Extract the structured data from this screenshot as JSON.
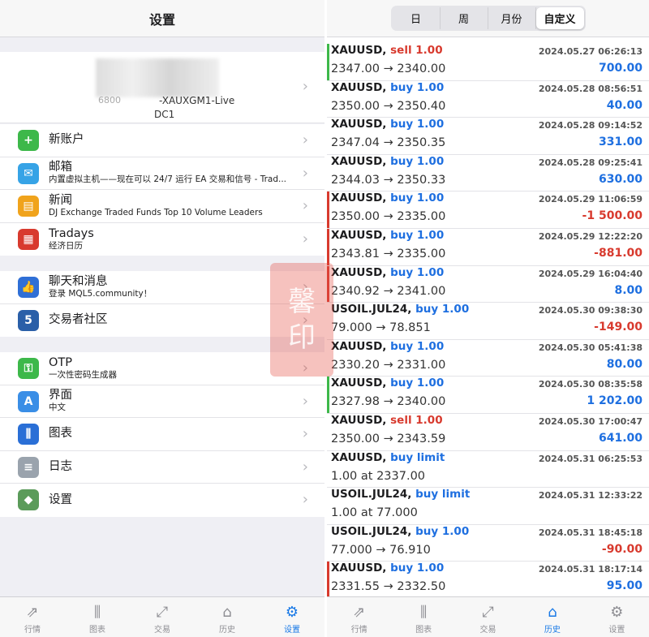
{
  "left": {
    "title": "设置",
    "account": {
      "number_partial": "6800",
      "server": "-XAUXGM1-Live",
      "dc": "DC1"
    },
    "group1": [
      {
        "icon": "new-account-icon",
        "color": "#3db84a",
        "glyph": "+",
        "title": "新账户",
        "sub": ""
      },
      {
        "icon": "mail-icon",
        "color": "#36a3e6",
        "glyph": "✉",
        "title": "邮箱",
        "sub": "内置虚拟主机——现在可以 24/7 运行 EA 交易和信号 - Trad..."
      },
      {
        "icon": "news-icon",
        "color": "#f0a31c",
        "glyph": "▤",
        "title": "新闻",
        "sub": "DJ Exchange Traded Funds Top 10 Volume Leaders"
      },
      {
        "icon": "tradays-icon",
        "color": "#d83a2e",
        "glyph": "▦",
        "title": "Tradays",
        "sub": "经济日历"
      }
    ],
    "group2": [
      {
        "icon": "chat-icon",
        "color": "#2f6fd6",
        "glyph": "👍",
        "title": "聊天和消息",
        "sub": "登录 MQL5.community！"
      },
      {
        "icon": "mql5-icon",
        "color": "#2a5fa8",
        "glyph": "5",
        "title": "交易者社区",
        "sub": ""
      }
    ],
    "group3": [
      {
        "icon": "otp-icon",
        "color": "#3db84a",
        "glyph": "⚿",
        "title": "OTP",
        "sub": "一次性密码生成器"
      },
      {
        "icon": "language-icon",
        "color": "#3a8ee6",
        "glyph": "A",
        "title": "界面",
        "sub": "中文"
      },
      {
        "icon": "chart-icon",
        "color": "#2a6fd6",
        "glyph": "⫼",
        "title": "图表",
        "sub": ""
      },
      {
        "icon": "journal-icon",
        "color": "#9aa3ad",
        "glyph": "≡",
        "title": "日志",
        "sub": ""
      },
      {
        "icon": "settings-icon",
        "color": "#5b9b5a",
        "glyph": "◆",
        "title": "设置",
        "sub": ""
      }
    ],
    "tabs": [
      {
        "label": "行情",
        "icon": "quotes-icon",
        "glyph": "⇗",
        "active": false
      },
      {
        "label": "图表",
        "icon": "chart-icon",
        "glyph": "⫼",
        "active": false
      },
      {
        "label": "交易",
        "icon": "trade-icon",
        "glyph": "⤢",
        "active": false
      },
      {
        "label": "历史",
        "icon": "history-icon",
        "glyph": "⌂",
        "active": false
      },
      {
        "label": "设置",
        "icon": "gear-icon",
        "glyph": "⚙",
        "active": true
      }
    ]
  },
  "watermark": [
    "馨",
    "印"
  ],
  "right": {
    "segments": [
      {
        "label": "日",
        "active": false
      },
      {
        "label": "周",
        "active": false
      },
      {
        "label": "月份",
        "active": false
      },
      {
        "label": "自定义",
        "active": true
      }
    ],
    "trades": [
      {
        "sym": "XAUUSD,",
        "action": "sell 1.00",
        "side": "sell",
        "prices": "2347.00 → 2340.00",
        "time": "2024.05.27 06:26:13",
        "pl": "700.00",
        "sign": "pos",
        "bar": "#3db84a"
      },
      {
        "sym": "XAUUSD,",
        "action": "buy 1.00",
        "side": "buy",
        "prices": "2350.00 → 2350.40",
        "time": "2024.05.28 08:56:51",
        "pl": "40.00",
        "sign": "pos",
        "bar": ""
      },
      {
        "sym": "XAUUSD,",
        "action": "buy 1.00",
        "side": "buy",
        "prices": "2347.04 → 2350.35",
        "time": "2024.05.28 09:14:52",
        "pl": "331.00",
        "sign": "pos",
        "bar": ""
      },
      {
        "sym": "XAUUSD,",
        "action": "buy 1.00",
        "side": "buy",
        "prices": "2344.03 → 2350.33",
        "time": "2024.05.28 09:25:41",
        "pl": "630.00",
        "sign": "pos",
        "bar": ""
      },
      {
        "sym": "XAUUSD,",
        "action": "buy 1.00",
        "side": "buy",
        "prices": "2350.00 → 2335.00",
        "time": "2024.05.29 11:06:59",
        "pl": "-1 500.00",
        "sign": "neg",
        "bar": "#d83a2e"
      },
      {
        "sym": "XAUUSD,",
        "action": "buy 1.00",
        "side": "buy",
        "prices": "2343.81 → 2335.00",
        "time": "2024.05.29 12:22:20",
        "pl": "-881.00",
        "sign": "neg",
        "bar": "#d83a2e"
      },
      {
        "sym": "XAUUSD,",
        "action": "buy 1.00",
        "side": "buy",
        "prices": "2340.92 → 2341.00",
        "time": "2024.05.29 16:04:40",
        "pl": "8.00",
        "sign": "pos",
        "bar": "#d83a2e"
      },
      {
        "sym": "USOIL.JUL24,",
        "action": "buy 1.00",
        "side": "buy",
        "prices": "79.000 → 78.851",
        "time": "2024.05.30 09:38:30",
        "pl": "-149.00",
        "sign": "neg",
        "bar": ""
      },
      {
        "sym": "XAUUSD,",
        "action": "buy 1.00",
        "side": "buy",
        "prices": "2330.20 → 2331.00",
        "time": "2024.05.30 05:41:38",
        "pl": "80.00",
        "sign": "pos",
        "bar": ""
      },
      {
        "sym": "XAUUSD,",
        "action": "buy 1.00",
        "side": "buy",
        "prices": "2327.98 → 2340.00",
        "time": "2024.05.30 08:35:58",
        "pl": "1 202.00",
        "sign": "pos",
        "bar": "#3db84a"
      },
      {
        "sym": "XAUUSD,",
        "action": "sell 1.00",
        "side": "sell",
        "prices": "2350.00 → 2343.59",
        "time": "2024.05.30 17:00:47",
        "pl": "641.00",
        "sign": "pos",
        "bar": ""
      },
      {
        "sym": "XAUUSD,",
        "action": "buy limit",
        "side": "buy",
        "prices": "1.00 at 2337.00",
        "time": "2024.05.31 06:25:53",
        "pl": "",
        "sign": "pos",
        "bar": ""
      },
      {
        "sym": "USOIL.JUL24,",
        "action": "buy limit",
        "side": "buy",
        "prices": "1.00 at 77.000",
        "time": "2024.05.31 12:33:22",
        "pl": "",
        "sign": "pos",
        "bar": ""
      },
      {
        "sym": "USOIL.JUL24,",
        "action": "buy 1.00",
        "side": "buy",
        "prices": "77.000 → 76.910",
        "time": "2024.05.31 18:45:18",
        "pl": "-90.00",
        "sign": "neg",
        "bar": ""
      },
      {
        "sym": "XAUUSD,",
        "action": "buy 1.00",
        "side": "buy",
        "prices": "2331.55 → 2332.50",
        "time": "2024.05.31 18:17:14",
        "pl": "95.00",
        "sign": "pos",
        "bar": "#d83a2e"
      }
    ],
    "tabs": [
      {
        "label": "行情",
        "icon": "quotes-icon",
        "glyph": "⇗",
        "active": false
      },
      {
        "label": "图表",
        "icon": "chart-icon",
        "glyph": "⫼",
        "active": false
      },
      {
        "label": "交易",
        "icon": "trade-icon",
        "glyph": "⤢",
        "active": false
      },
      {
        "label": "历史",
        "icon": "history-icon",
        "glyph": "⌂",
        "active": true
      },
      {
        "label": "设置",
        "icon": "gear-icon",
        "glyph": "⚙",
        "active": false
      }
    ]
  }
}
